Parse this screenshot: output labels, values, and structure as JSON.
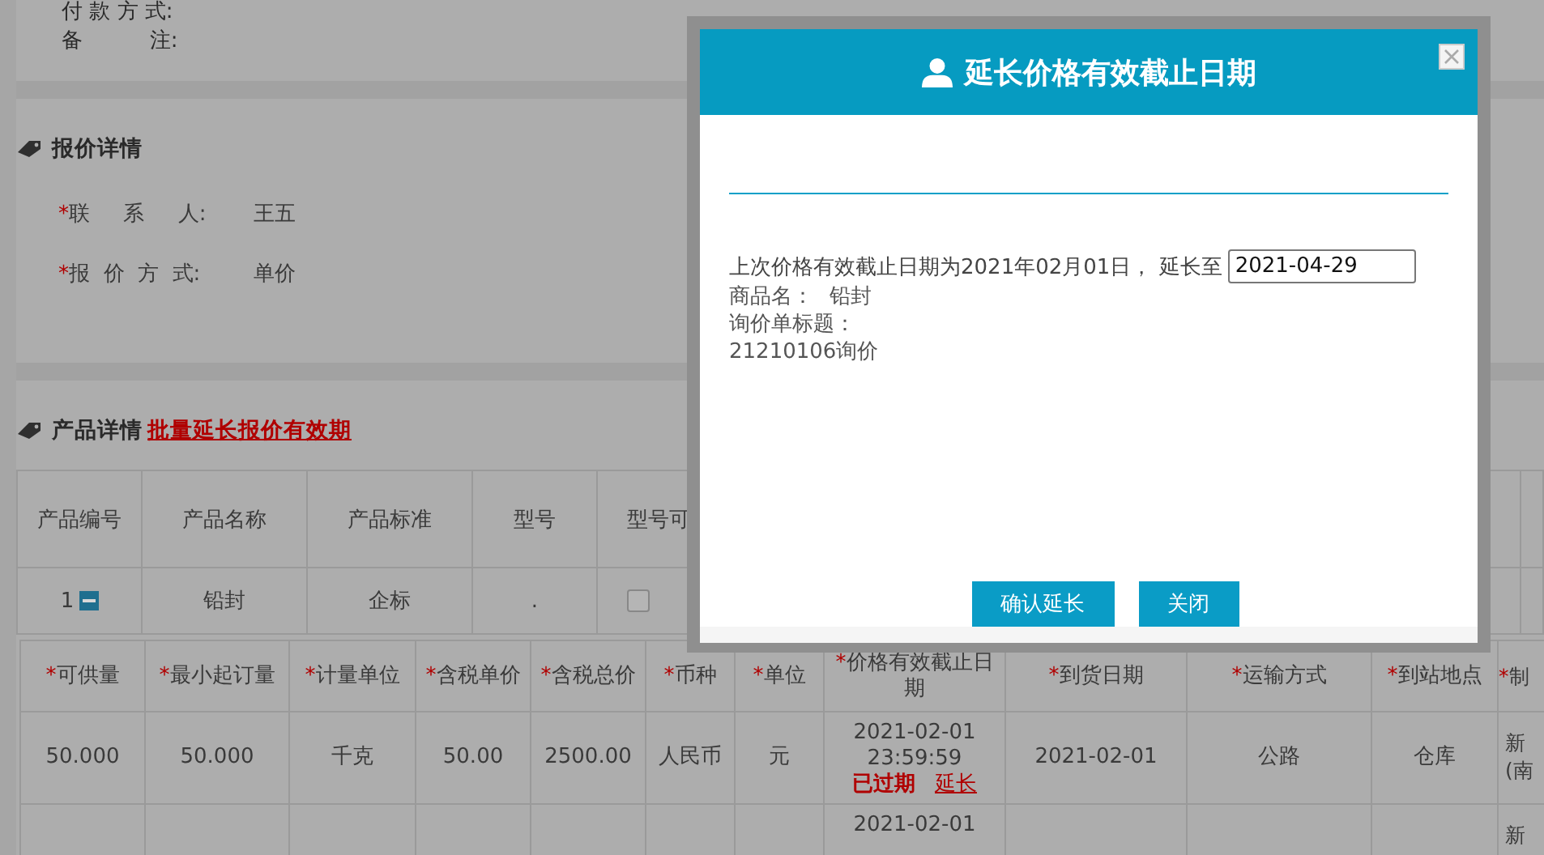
{
  "info_fields": [
    {
      "label": "付 款 方 式:"
    },
    {
      "label": "备          注:"
    }
  ],
  "quote_details": {
    "title": "报价详情",
    "fields": [
      {
        "label": "联     系     人:",
        "value": "王五",
        "required_mark": "*"
      },
      {
        "label": "报  价  方  式:",
        "value": "单价",
        "required_mark": "*"
      }
    ]
  },
  "product_details": {
    "title": "产品详情",
    "link": "批量延长报价有效期"
  },
  "product_table": {
    "columns": [
      "产品编号",
      "产品名称",
      "产品标准",
      "型号",
      "型号可"
    ],
    "rows": [
      {
        "number": "1",
        "expanded": true,
        "name": "铅封",
        "standard": "企标",
        "model": ".",
        "substitutable": false
      }
    ]
  },
  "quote_table": {
    "columns": [
      {
        "label": "可供量",
        "required_mark": "*"
      },
      {
        "label": "最小起订量",
        "required_mark": "*"
      },
      {
        "label": "计量单位",
        "required_mark": "*"
      },
      {
        "label": "含税单价",
        "required_mark": "*"
      },
      {
        "label": "含税总价",
        "required_mark": "*"
      },
      {
        "label": "币种",
        "required_mark": "*"
      },
      {
        "label": "单位",
        "required_mark": "*"
      },
      {
        "label": "价格有效截止日期",
        "required_mark": "*"
      },
      {
        "label": "到货日期",
        "required_mark": "*"
      },
      {
        "label": "运输方式",
        "required_mark": "*"
      },
      {
        "label": "到站地点",
        "required_mark": "*"
      },
      {
        "label": "制",
        "required_mark": "*"
      }
    ],
    "rows": [
      {
        "cells": [
          "50.000",
          "50.000",
          "千克",
          "50.00",
          "2500.00",
          "人民币",
          "元"
        ],
        "expiry": {
          "date": "2021-02-01",
          "time": "23:59:59",
          "status": "已过期",
          "link": "延长"
        },
        "arrival": "2021-02-01",
        "transport": "公路",
        "station": "仓库",
        "maker": [
          "新",
          "(南"
        ]
      },
      {
        "expiry": {
          "date": "2021-02-01"
        },
        "maker": [
          "新"
        ]
      }
    ]
  },
  "modal": {
    "title": "延长价格有效截止日期",
    "message": "上次价格有效截止日期为2021年02月01日， 延长至",
    "date_input": "2021-04-29",
    "product_label": "商品名：",
    "product_name": "铅封",
    "inquiry_title_label": "询价单标题：",
    "inquiry_title": "21210106询价",
    "buttons": [
      "确认延长",
      "关闭"
    ]
  }
}
